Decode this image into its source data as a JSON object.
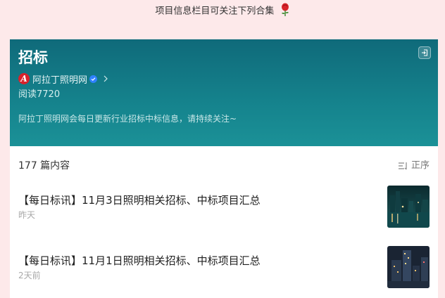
{
  "caption": {
    "text": "项目信息栏目可关注下列合集",
    "icon": "rose-icon"
  },
  "collection": {
    "title": "招标",
    "account_name": "阿拉丁照明网",
    "logo_letter": "A",
    "reads": "阅读7720",
    "description": "阿拉丁照明网会每日更新行业招标中标信息，请持续关注~"
  },
  "list": {
    "count_label": "177 篇内容",
    "sort_label": "正序",
    "items": [
      {
        "title": "【每日标讯】11月3日照明相关招标、中标项目汇总",
        "time": "昨天",
        "thumb": "night-city-waterfront"
      },
      {
        "title": "【每日标讯】11月1日照明相关招标、中标项目汇总",
        "time": "2天前",
        "thumb": "night-skyscrapers"
      }
    ]
  },
  "colors": {
    "page_bg": "#fde9ea",
    "header_top": "#0f6a7a",
    "header_bottom": "#1b9197",
    "logo_red": "#d7222b",
    "verified_blue": "#2f82ff"
  }
}
